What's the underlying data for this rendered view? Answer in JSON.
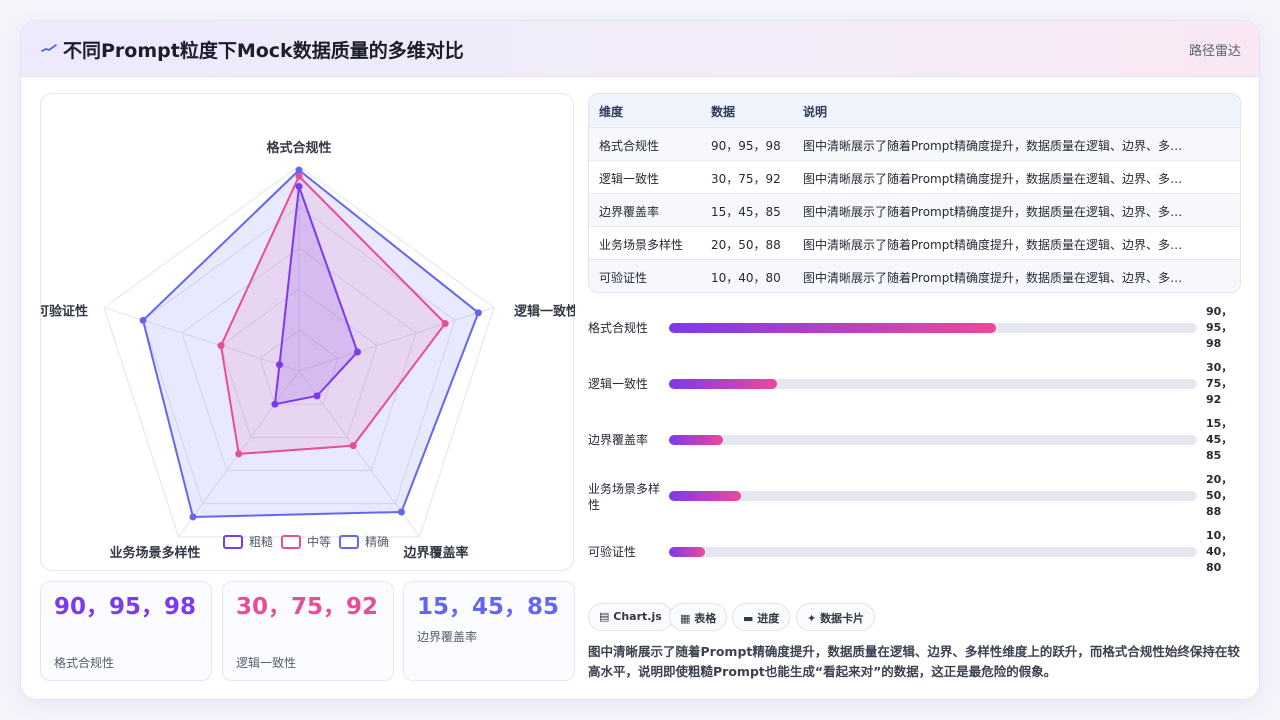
{
  "header": {
    "icon": "wave-icon",
    "title": "不同Prompt粒度下Mock数据质量的多维对比",
    "right_label": "路径雷达"
  },
  "chart_data": {
    "type": "radar",
    "axes": [
      "格式合规性",
      "逻辑一致性",
      "边界覆盖率",
      "业务场景多样性",
      "可验证性"
    ],
    "rmax": 100,
    "grid_levels": [
      20,
      40,
      60,
      80,
      100
    ],
    "series": [
      {
        "name": "粗糙",
        "values": [
          90,
          30,
          15,
          20,
          10
        ],
        "color": "#7c3aed"
      },
      {
        "name": "中等",
        "values": [
          95,
          75,
          45,
          50,
          40
        ],
        "color": "#e64d9b"
      },
      {
        "name": "精确",
        "values": [
          98,
          92,
          85,
          88,
          80
        ],
        "color": "#6366f1"
      }
    ],
    "legend_position": "bottom"
  },
  "kpis": [
    {
      "value": "90，95，98",
      "label": "格式合规性",
      "color": "#7c3aed"
    },
    {
      "value": "30，75，92",
      "label": "逻辑一致性",
      "color": "#e64d9b"
    },
    {
      "value": "15，45，85",
      "label": "边界覆盖率",
      "color": "#6366f1"
    }
  ],
  "table": {
    "headers": [
      "维度",
      "数据",
      "说明"
    ],
    "rows": [
      [
        "格式合规性",
        "90，95，98",
        "图中清晰展示了随着Prompt精确度提升，数据质量在逻辑、边界、多样..."
      ],
      [
        "逻辑一致性",
        "30，75，92",
        "图中清晰展示了随着Prompt精确度提升，数据质量在逻辑、边界、多样..."
      ],
      [
        "边界覆盖率",
        "15，45，85",
        "图中清晰展示了随着Prompt精确度提升，数据质量在逻辑、边界、多样..."
      ],
      [
        "业务场景多样性",
        "20，50，88",
        "图中清晰展示了随着Prompt精确度提升，数据质量在逻辑、边界、多样..."
      ],
      [
        "可验证性",
        "10，40，80",
        "图中清晰展示了随着Prompt精确度提升，数据质量在逻辑、边界、多样..."
      ]
    ]
  },
  "bars": [
    {
      "label": "格式合规性",
      "value_text": "90，95，98",
      "fill": 0.62
    },
    {
      "label": "逻辑一致性",
      "value_text": "30，75，92",
      "fill": 0.205
    },
    {
      "label": "边界覆盖率",
      "value_text": "15，45，85",
      "fill": 0.102
    },
    {
      "label": "业务场景多样性",
      "value_text": "20，50，88",
      "fill": 0.137
    },
    {
      "label": "可验证性",
      "value_text": "10，40，80",
      "fill": 0.068
    }
  ],
  "chips": [
    {
      "icon": "chart-icon",
      "glyph": "▤",
      "label": "Chart.js"
    },
    {
      "icon": "table-icon",
      "glyph": "▦",
      "label": "表格"
    },
    {
      "icon": "progress-icon",
      "glyph": "▬",
      "label": "进度"
    },
    {
      "icon": "sparkle-icon",
      "glyph": "✦",
      "label": "数据卡片"
    }
  ],
  "description": "图中清晰展示了随着Prompt精确度提升，数据质量在逻辑、边界、多样性维度上的跃升，而格式合规性始终保持在较高水平，说明即使粗糙Prompt也能生成“看起来对”的数据，这正是最危险的假象。"
}
